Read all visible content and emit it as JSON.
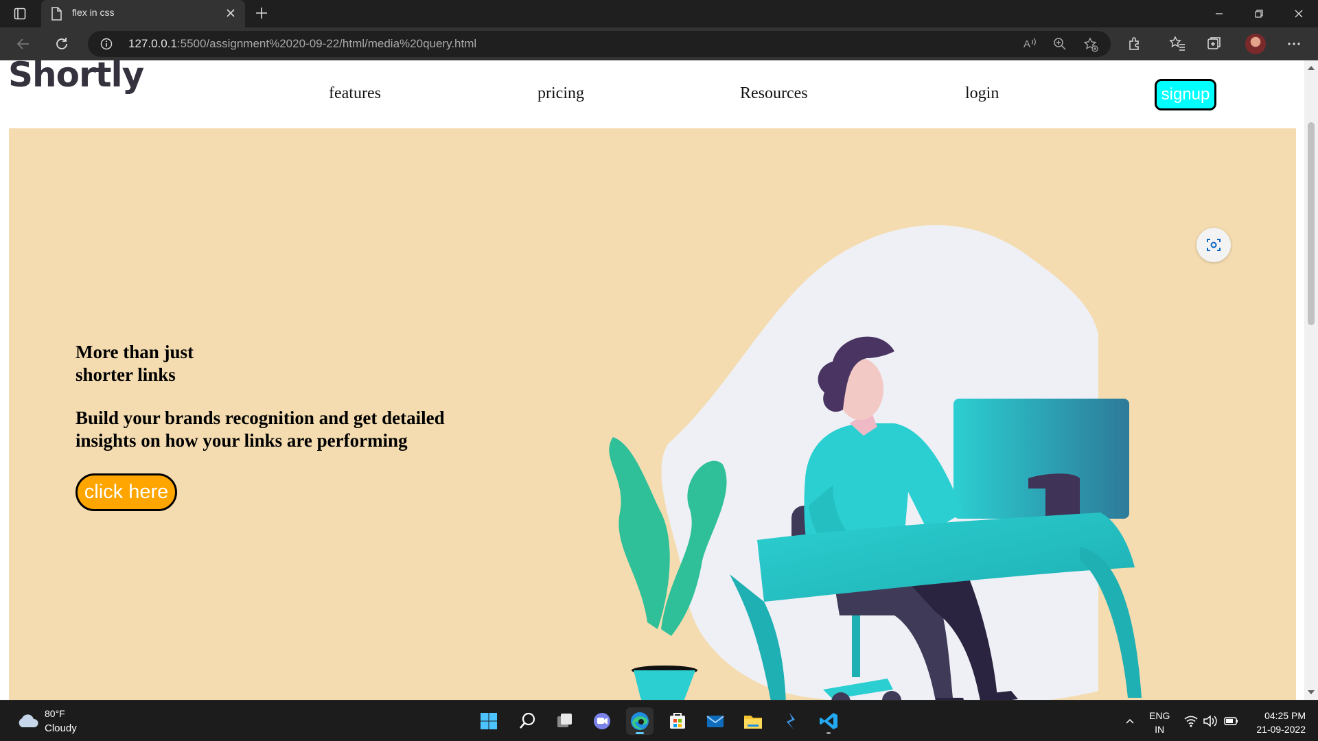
{
  "browser": {
    "tab_title": "flex in css",
    "url_host": "127.0.0.1",
    "url_rest": ":5500/assignment%2020-09-22/html/media%20query.html"
  },
  "page": {
    "logo": "Shortly",
    "nav": [
      "features",
      "pricing",
      "Resources",
      "login"
    ],
    "signup_label": "signup",
    "hero": {
      "heading": "More than just shorter links",
      "subheading": "Build your brands recognition and get detailed insights on how your links are performing",
      "cta_label": "click here"
    }
  },
  "taskbar": {
    "weather_temp": "80°F",
    "weather_cond": "Cloudy",
    "lang_line1": "ENG",
    "lang_line2": "IN",
    "time": "04:25 PM",
    "date": "21-09-2022"
  },
  "colors": {
    "hero_bg": "#f4dcb0",
    "signup_bg": "#00ffff",
    "cta_bg": "#ffa500",
    "illustration_teal": "#2ccfd1"
  }
}
